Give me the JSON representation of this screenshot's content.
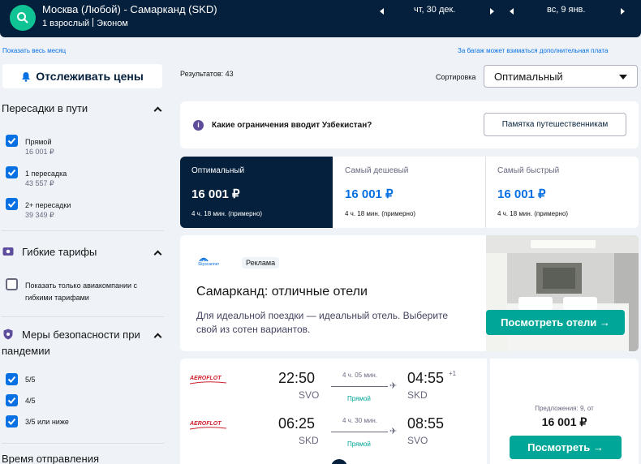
{
  "header": {
    "route": "Москва (Любой) - Самарканд (SKD)",
    "passengers": "1 взрослый",
    "cabin": "Эконом",
    "depart_date": "чт, 30 дек.",
    "return_date": "вс, 9 янв."
  },
  "links": {
    "show_month": "Показать весь месяц",
    "baggage_note": "За багаж может взиматься дополнительная плата"
  },
  "sidebar": {
    "track_prices": "Отслеживать цены",
    "stops": {
      "title": "Пересадки в пути",
      "options": [
        {
          "label": "Прямой",
          "price": "16 001 ₽",
          "checked": true
        },
        {
          "label": "1 пересадка",
          "price": "43 557 ₽",
          "checked": true
        },
        {
          "label": "2+ пересадки",
          "price": "39 349 ₽",
          "checked": true
        }
      ]
    },
    "flexible": {
      "title": "Гибкие тарифы",
      "option_line1": "Показать только авиакомпании с",
      "option_line2": "гибкими тарифами"
    },
    "safety": {
      "title_line1": "Меры безопасности при",
      "title_line2": "пандемии",
      "options": [
        "5/5",
        "4/5",
        "3/5 или ниже"
      ]
    },
    "departure_time": {
      "title": "Время отправления"
    }
  },
  "main": {
    "results_count": "Результатов: 43",
    "sort_label": "Сортировка",
    "sort_value": "Оптимальный",
    "info_banner": {
      "icon": "i",
      "question": "Какие ограничения вводит Узбекистан?",
      "button": "Памятка путешественникам"
    },
    "tabs": [
      {
        "title": "Оптимальный",
        "price": "16 001 ₽",
        "duration": "4 ч. 18 мин. (примерно)",
        "active": true
      },
      {
        "title": "Самый дешевый",
        "price": "16 001 ₽",
        "duration": "4 ч. 18 мин. (примерно)",
        "active": false
      },
      {
        "title": "Самый быстрый",
        "price": "16 001 ₽",
        "duration": "4 ч. 18 мин. (примерно)",
        "active": false
      }
    ],
    "ad": {
      "brand": "Skyscanner",
      "badge": "Реклама",
      "title": "Самарканд: отличные отели",
      "text_line1": "Для идеальной поездки — идеальный отель. Выберите",
      "text_line2": "свой из сотен вариантов.",
      "button": "Посмотреть отели →"
    },
    "flight": {
      "airline": "AEROFLOT",
      "legs": [
        {
          "dep_time": "22:50",
          "dep_code": "SVO",
          "duration": "4 ч. 05 мин.",
          "stops": "Прямой",
          "arr_time": "04:55",
          "day_offset": "+1",
          "arr_code": "SKD"
        },
        {
          "dep_time": "06:25",
          "dep_code": "SKD",
          "duration": "4 ч. 30 мин.",
          "stops": "Прямой",
          "arr_time": "08:55",
          "day_offset": "",
          "arr_code": "SVO"
        }
      ],
      "offers": "Предложения: 9, от",
      "price": "16 001 ₽",
      "button": "Посмотреть →"
    }
  },
  "colors": {
    "navy": "#05203c",
    "blue": "#0770e3",
    "teal": "#00a698",
    "accent_green": "#0fc394"
  }
}
